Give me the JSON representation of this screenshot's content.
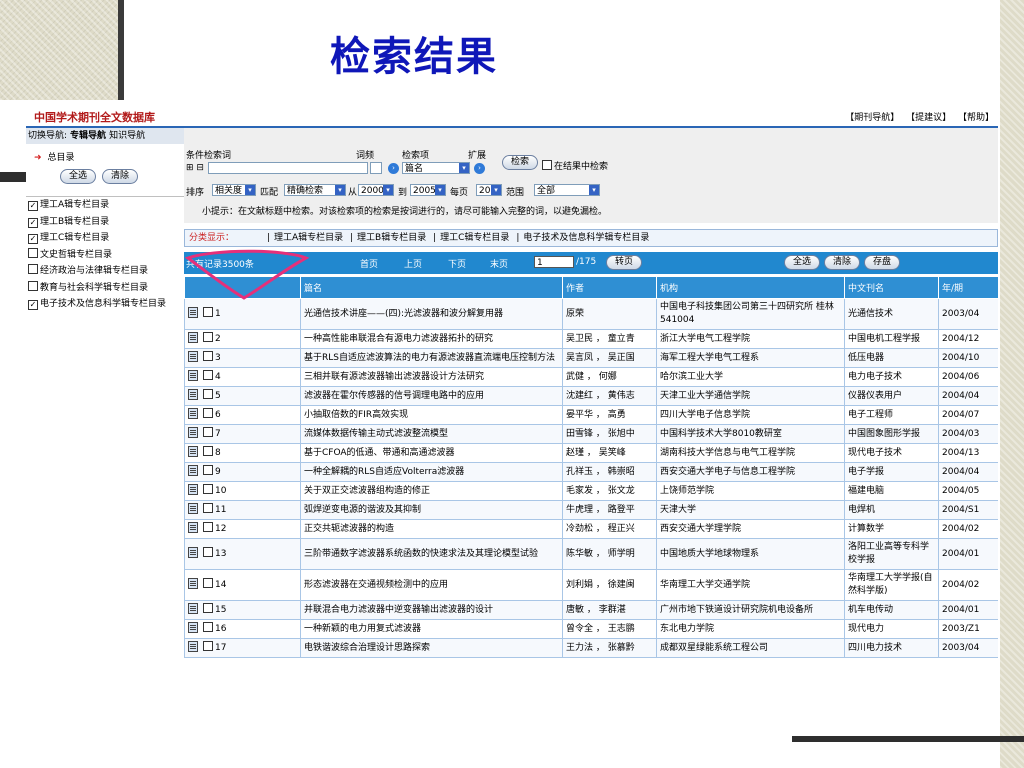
{
  "slide": {
    "title": "检索结果"
  },
  "header": {
    "db_title": "中国学术期刊全文数据库",
    "links": [
      "【期刊导航】",
      "【提建议】",
      "【帮助】"
    ]
  },
  "nav": {
    "switch_label": "切换导航:",
    "tab_active": "专辑导航",
    "tab_other": "知识导航",
    "home": "总目录",
    "btn_select_all": "全选",
    "btn_clear": "清除",
    "categories": [
      {
        "label": "理工A辑专栏目录",
        "checked": true
      },
      {
        "label": "理工B辑专栏目录",
        "checked": true
      },
      {
        "label": "理工C辑专栏目录",
        "checked": true
      },
      {
        "label": "文史哲辑专栏目录",
        "checked": false
      },
      {
        "label": "经济政治与法律辑专栏目录",
        "checked": false
      },
      {
        "label": "教育与社会科学辑专栏目录",
        "checked": false
      },
      {
        "label": "电子技术及信息科学辑专栏目录",
        "checked": true
      }
    ]
  },
  "search": {
    "cond_label": "条件检索词",
    "freq_label": "词频",
    "field_label": "检索项",
    "ext_label": "扩展",
    "plusminus": "⊞ ⊟",
    "field_value": "篇名",
    "search_btn": "检索",
    "in_result": "在结果中检索",
    "sort_label": "排序",
    "sort_value": "相关度",
    "match_label": "匹配",
    "match_value": "精确检索",
    "from_label": "从",
    "from_year": "2000",
    "to_label": "到",
    "to_year": "2005",
    "perpage_label": "每页",
    "perpage_value": "20",
    "range_label": "范围",
    "range_value": "全部",
    "tip": "小提示：在文献标题中检索。对该检索项的检索是按词进行的，请尽可能输入完整的词，以避免漏检。"
  },
  "classify": {
    "label": "分类显示：",
    "items": [
      "理工A辑专栏目录",
      "理工B辑专栏目录",
      "理工C辑专栏目录",
      "电子技术及信息科学辑专栏目录"
    ]
  },
  "results_bar": {
    "total": "共有记录3500条",
    "first": "首页",
    "prev": "上页",
    "next": "下页",
    "last": "末页",
    "page": "1",
    "of_pages": "/175",
    "goto": "转页",
    "select_all": "全选",
    "clear": "清除",
    "save": "存盘"
  },
  "table": {
    "headers": [
      "",
      "篇名",
      "作者",
      "机构",
      "中文刊名",
      "年/期"
    ],
    "rows": [
      {
        "n": "1",
        "title": "光通信技术讲座——(四):光滤波器和波分解复用器",
        "author": "原荣",
        "org": "中国电子科技集团公司第三十四研究所 桂林541004",
        "journal": "光通信技术",
        "issue": "2003/04"
      },
      {
        "n": "2",
        "title": "一种高性能串联混合有源电力滤波器拓扑的研究",
        "author": "吴卫民 ， 童立青",
        "org": "浙江大学电气工程学院",
        "journal": "中国电机工程学报",
        "issue": "2004/12"
      },
      {
        "n": "3",
        "title": "基于RLS自适应滤波算法的电力有源滤波器直流端电压控制方法",
        "author": "吴言凤 ， 吴正国",
        "org": "海军工程大学电气工程系",
        "journal": "低压电器",
        "issue": "2004/10"
      },
      {
        "n": "4",
        "title": "三相并联有源滤波器输出滤波器设计方法研究",
        "author": "武健 ， 何娜",
        "org": "哈尔滨工业大学",
        "journal": "电力电子技术",
        "issue": "2004/06"
      },
      {
        "n": "5",
        "title": "滤波器在霍尔传感器的信号调理电路中的应用",
        "author": "沈建红 ， 黄伟志",
        "org": "天津工业大学通信学院",
        "journal": "仪器仪表用户",
        "issue": "2004/04"
      },
      {
        "n": "6",
        "title": "小抽取倍数的FIR高效实现",
        "author": "晏平华 ， 高勇",
        "org": "四川大学电子信息学院",
        "journal": "电子工程师",
        "issue": "2004/07"
      },
      {
        "n": "7",
        "title": "流媒体数据传输主动式滤波整流模型",
        "author": "田雪锋 ， 张旭中",
        "org": "中国科学技术大学8010教研室",
        "journal": "中国图象图形学报",
        "issue": "2004/03"
      },
      {
        "n": "8",
        "title": "基于CFOA的低通、带通和高通滤波器",
        "author": "赵瑾 ， 吴笑峰",
        "org": "湖南科技大学信息与电气工程学院",
        "journal": "现代电子技术",
        "issue": "2004/13"
      },
      {
        "n": "9",
        "title": "一种全解耦的RLS自适应Volterra滤波器",
        "author": "孔祥玉 ， 韩崇昭",
        "org": "西安交通大学电子与信息工程学院",
        "journal": "电子学报",
        "issue": "2004/04"
      },
      {
        "n": "10",
        "title": "关于双正交滤波器组构造的修正",
        "author": "毛家发 ， 张文龙",
        "org": "上饶师范学院",
        "journal": "福建电脑",
        "issue": "2004/05"
      },
      {
        "n": "11",
        "title": "弧焊逆变电源的谐波及其抑制",
        "author": "牛虎理 ， 路登平",
        "org": "天津大学",
        "journal": "电焊机",
        "issue": "2004/S1"
      },
      {
        "n": "12",
        "title": "正交共轭滤波器的构造",
        "author": "冷劲松 ， 程正兴",
        "org": "西安交通大学理学院",
        "journal": "计算数学",
        "issue": "2004/02"
      },
      {
        "n": "13",
        "title": "三阶带通数字滤波器系统函数的快速求法及其理论模型试验",
        "author": "陈华敏 ， 师学明",
        "org": "中国地质大学地球物理系",
        "journal": "洛阳工业高等专科学校学报",
        "issue": "2004/01"
      },
      {
        "n": "14",
        "title": "形态滤波器在交通视频检测中的应用",
        "author": "刘利娟 ， 徐建闽",
        "org": "华南理工大学交通学院",
        "journal": "华南理工大学学报(自然科学版)",
        "issue": "2004/02"
      },
      {
        "n": "15",
        "title": "并联混合电力滤波器中逆变器输出滤波器的设计",
        "author": "唐敏 ， 李群湛",
        "org": "广州市地下铁道设计研究院机电设备所",
        "journal": "机车电传动",
        "issue": "2004/01"
      },
      {
        "n": "16",
        "title": "一种新颖的电力用复式滤波器",
        "author": "曾令全 ， 王志鹏",
        "org": "东北电力学院",
        "journal": "现代电力",
        "issue": "2003/Z1"
      },
      {
        "n": "17",
        "title": "电铁谐波综合治理设计思路探索",
        "author": "王力法 ， 张慕黔",
        "org": "成都双星绿能系统工程公司",
        "journal": "四川电力技术",
        "issue": "2003/04"
      }
    ]
  }
}
